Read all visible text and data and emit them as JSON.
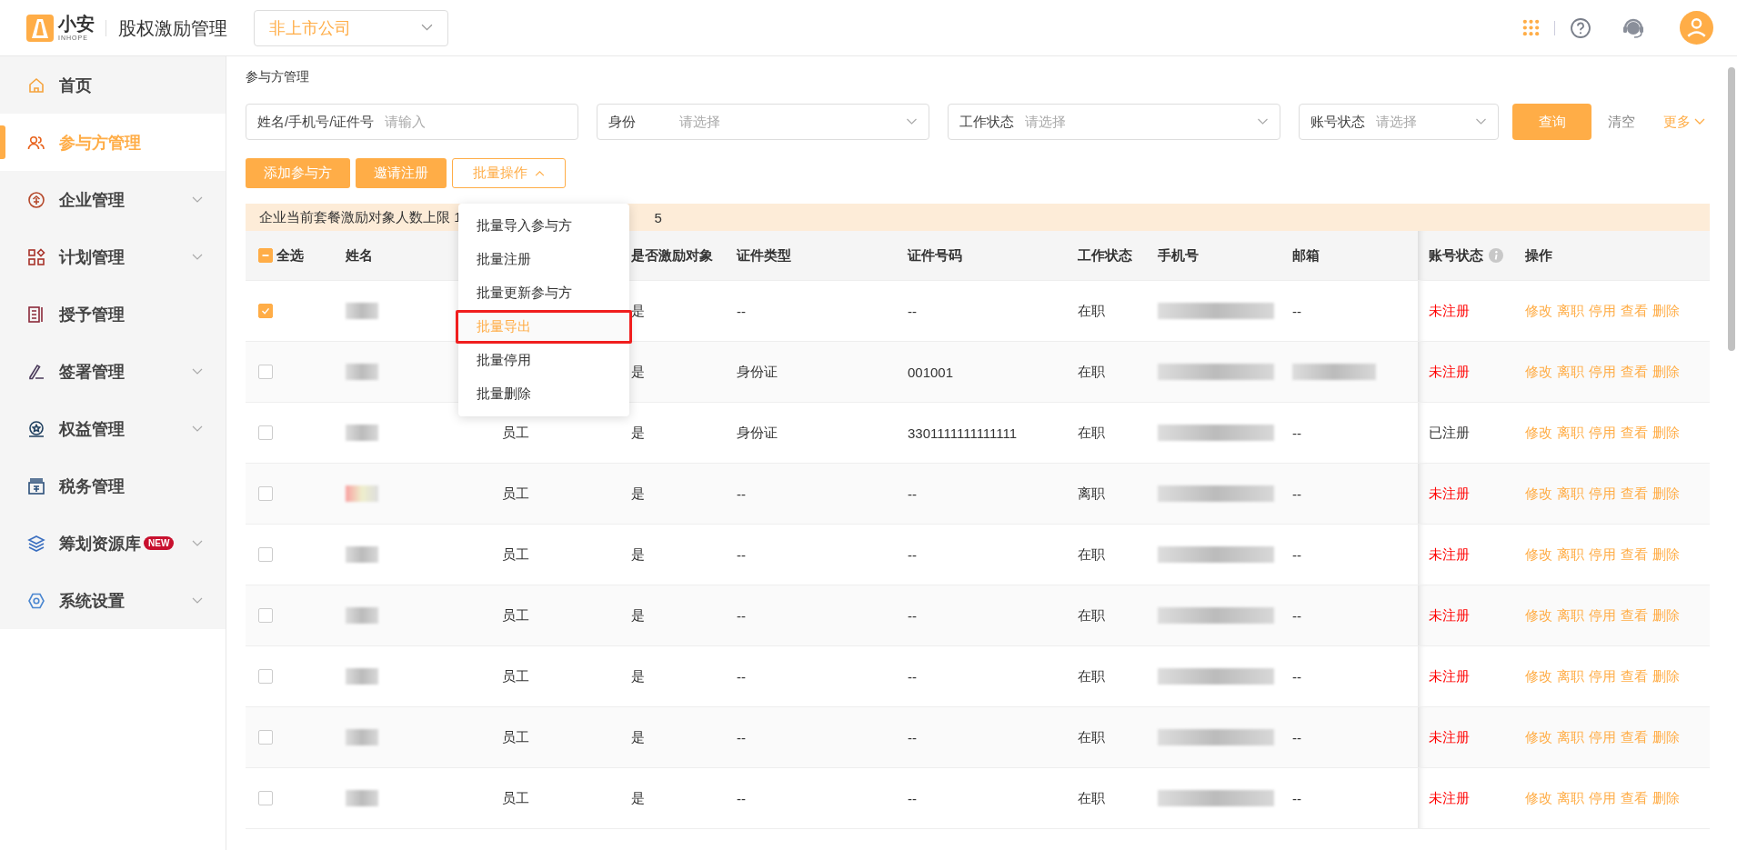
{
  "header": {
    "logo_text": "小安",
    "logo_subtext": "INHOPE",
    "app_title": "股权激励管理",
    "company_select": "非上市公司"
  },
  "sidebar": {
    "items": [
      {
        "label": "首页",
        "selected": false,
        "has_submenu": false
      },
      {
        "label": "参与方管理",
        "selected": true,
        "has_submenu": false
      },
      {
        "label": "企业管理",
        "selected": false,
        "has_submenu": true
      },
      {
        "label": "计划管理",
        "selected": false,
        "has_submenu": true
      },
      {
        "label": "授予管理",
        "selected": false,
        "has_submenu": false
      },
      {
        "label": "签署管理",
        "selected": false,
        "has_submenu": true
      },
      {
        "label": "权益管理",
        "selected": false,
        "has_submenu": true
      },
      {
        "label": "税务管理",
        "selected": false,
        "has_submenu": false
      },
      {
        "label": "筹划资源库",
        "selected": false,
        "has_submenu": true,
        "badge": "NEW"
      },
      {
        "label": "系统设置",
        "selected": false,
        "has_submenu": true
      }
    ]
  },
  "breadcrumb": "参与方管理",
  "filters": [
    {
      "kind": "input",
      "label": "姓名/手机号/证件号",
      "placeholder": "请输入"
    },
    {
      "kind": "select",
      "label": "身份",
      "placeholder": "请选择"
    },
    {
      "kind": "select",
      "label": "工作状态",
      "placeholder": "请选择"
    },
    {
      "kind": "select",
      "label": "账号状态",
      "placeholder": "请选择"
    }
  ],
  "filter_buttons": {
    "query": "查询",
    "clear": "清空",
    "more": "更多"
  },
  "actions": [
    {
      "label": "添加参与方",
      "kind": "primary"
    },
    {
      "label": "邀请注册",
      "kind": "primary"
    },
    {
      "label": "批量操作",
      "kind": "dropdown",
      "expanded": true
    }
  ],
  "batch_menu": [
    {
      "label": "批量导入参与方",
      "selected": false
    },
    {
      "label": "批量注册",
      "selected": false
    },
    {
      "label": "批量更新参与方",
      "selected": false
    },
    {
      "label": "批量导出",
      "selected": true
    },
    {
      "label": "批量停用",
      "selected": false
    },
    {
      "label": "批量删除",
      "selected": false
    }
  ],
  "notice": [
    "企业当前套餐激励对象人数上限 1",
    "5"
  ],
  "table": {
    "select_all": {
      "label": "全选",
      "indeterminate": true
    },
    "columns": {
      "name": "姓名",
      "incentive": "是否激励对象",
      "id_type": "证件类型",
      "id_number": "证件号码",
      "work_status": "工作状态",
      "phone": "手机号",
      "email": "邮箱",
      "account_status": "账号状态",
      "actions": "操作"
    },
    "rows": [
      {
        "checked": true,
        "incentive": "是",
        "id_type": "--",
        "id_number": "--",
        "work_status": "在职",
        "email": "--",
        "account_status": "未注册",
        "registered": false,
        "actions": [
          "修改",
          "离职",
          "停用",
          "查看",
          "删除"
        ]
      },
      {
        "checked": false,
        "incentive": "是",
        "id_type": "身份证",
        "id_number": "001001",
        "work_status": "在职",
        "account_status": "未注册",
        "registered": false,
        "actions": [
          "修改",
          "离职",
          "停用",
          "查看",
          "删除"
        ]
      },
      {
        "checked": false,
        "identity": "员工",
        "incentive": "是",
        "id_type": "身份证",
        "id_number": "3301111111111111",
        "work_status": "在职",
        "email": "--",
        "account_status": "已注册",
        "registered": true,
        "actions": [
          "修改",
          "离职",
          "停用",
          "查看",
          "删除"
        ]
      },
      {
        "checked": false,
        "identity": "员工",
        "incentive": "是",
        "id_type": "--",
        "id_number": "--",
        "work_status": "离职",
        "email": "--",
        "account_status": "未注册",
        "registered": false,
        "actions": [
          "修改",
          "离职",
          "停用",
          "查看",
          "删除"
        ]
      },
      {
        "checked": false,
        "identity": "员工",
        "incentive": "是",
        "id_type": "--",
        "id_number": "--",
        "work_status": "在职",
        "email": "--",
        "account_status": "未注册",
        "registered": false,
        "actions": [
          "修改",
          "离职",
          "停用",
          "查看",
          "删除"
        ]
      },
      {
        "checked": false,
        "identity": "员工",
        "incentive": "是",
        "id_type": "--",
        "id_number": "--",
        "work_status": "在职",
        "email": "--",
        "account_status": "未注册",
        "registered": false,
        "actions": [
          "修改",
          "离职",
          "停用",
          "查看",
          "删除"
        ]
      },
      {
        "checked": false,
        "identity": "员工",
        "incentive": "是",
        "id_type": "--",
        "id_number": "--",
        "work_status": "在职",
        "email": "--",
        "account_status": "未注册",
        "registered": false,
        "actions": [
          "修改",
          "离职",
          "停用",
          "查看",
          "删除"
        ]
      },
      {
        "checked": false,
        "identity": "员工",
        "incentive": "是",
        "id_type": "--",
        "id_number": "--",
        "work_status": "在职",
        "email": "--",
        "account_status": "未注册",
        "registered": false,
        "actions": [
          "修改",
          "离职",
          "停用",
          "查看",
          "删除"
        ]
      },
      {
        "checked": false,
        "identity": "员工",
        "incentive": "是",
        "id_type": "--",
        "id_number": "--",
        "work_status": "在职",
        "email": "--",
        "account_status": "未注册",
        "registered": false,
        "actions": [
          "修改",
          "离职",
          "停用",
          "查看",
          "删除"
        ]
      }
    ]
  }
}
